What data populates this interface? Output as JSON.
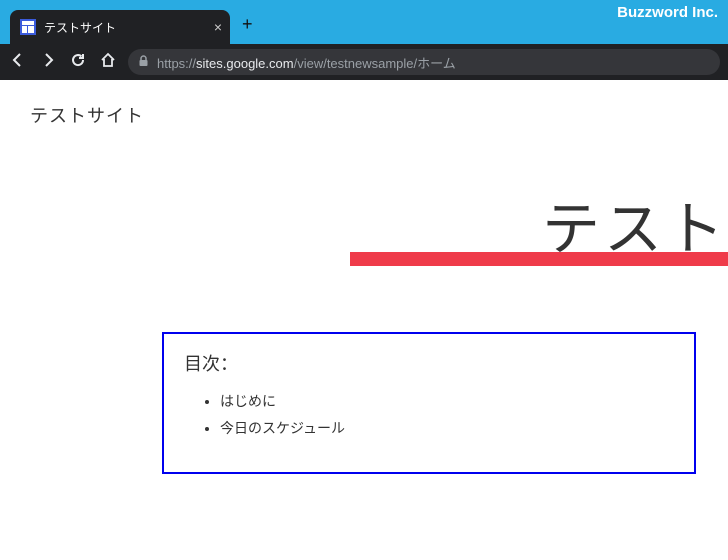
{
  "brand": {
    "label": "Buzzword Inc."
  },
  "tab": {
    "title": "テストサイト"
  },
  "url": {
    "scheme": "https://",
    "host": "sites.google.com",
    "path": "/view/testnewsample/ホーム"
  },
  "site": {
    "name": "テストサイト"
  },
  "hero": {
    "title": "テスト"
  },
  "toc": {
    "heading": "目次：",
    "items": [
      "はじめに",
      "今日のスケジュール"
    ]
  }
}
